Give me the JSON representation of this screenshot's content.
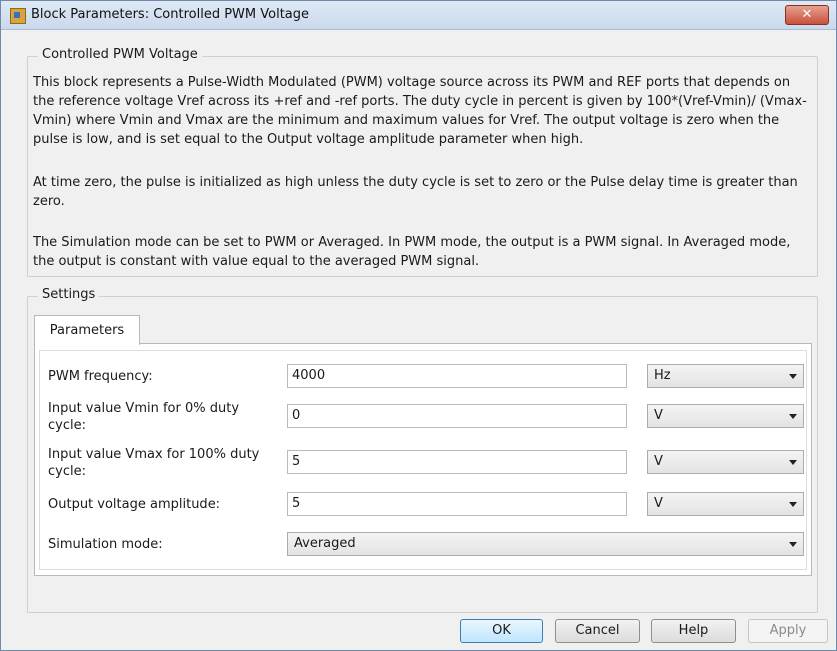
{
  "window": {
    "title": "Block Parameters: Controlled PWM Voltage",
    "close_label": "✕"
  },
  "description": {
    "group_label": "Controlled PWM Voltage",
    "paragraphs": [
      "This block represents a Pulse-Width Modulated (PWM) voltage source across its PWM and REF ports that depends on the reference voltage Vref across its +ref and -ref ports. The duty cycle in percent is given by 100*(Vref-Vmin)/ (Vmax-Vmin) where Vmin and Vmax are the minimum and maximum values for Vref. The output voltage is zero when the pulse is low, and is set equal to the Output voltage amplitude parameter when high.",
      "At time zero, the pulse is initialized as high unless the duty cycle is set to zero or the Pulse delay time is greater than zero.",
      "The Simulation mode can be set to PWM or Averaged. In PWM mode, the output is a PWM signal. In Averaged mode, the output is constant with value equal to the averaged PWM signal."
    ]
  },
  "settings": {
    "group_label": "Settings",
    "tab_label": "Parameters",
    "params": [
      {
        "label": "PWM frequency:",
        "value": "4000",
        "unit": "Hz"
      },
      {
        "label": "Input value Vmin for 0% duty cycle:",
        "value": "0",
        "unit": "V"
      },
      {
        "label": "Input value Vmax for 100% duty cycle:",
        "value": "5",
        "unit": "V"
      },
      {
        "label": "Output voltage amplitude:",
        "value": "5",
        "unit": "V"
      }
    ],
    "simulation_mode": {
      "label": "Simulation mode:",
      "value": "Averaged"
    }
  },
  "buttons": {
    "ok": "OK",
    "cancel": "Cancel",
    "help": "Help",
    "apply": "Apply"
  },
  "colors": {
    "ok_accent": "#3c7fb1",
    "close_red": "#c9503b"
  }
}
